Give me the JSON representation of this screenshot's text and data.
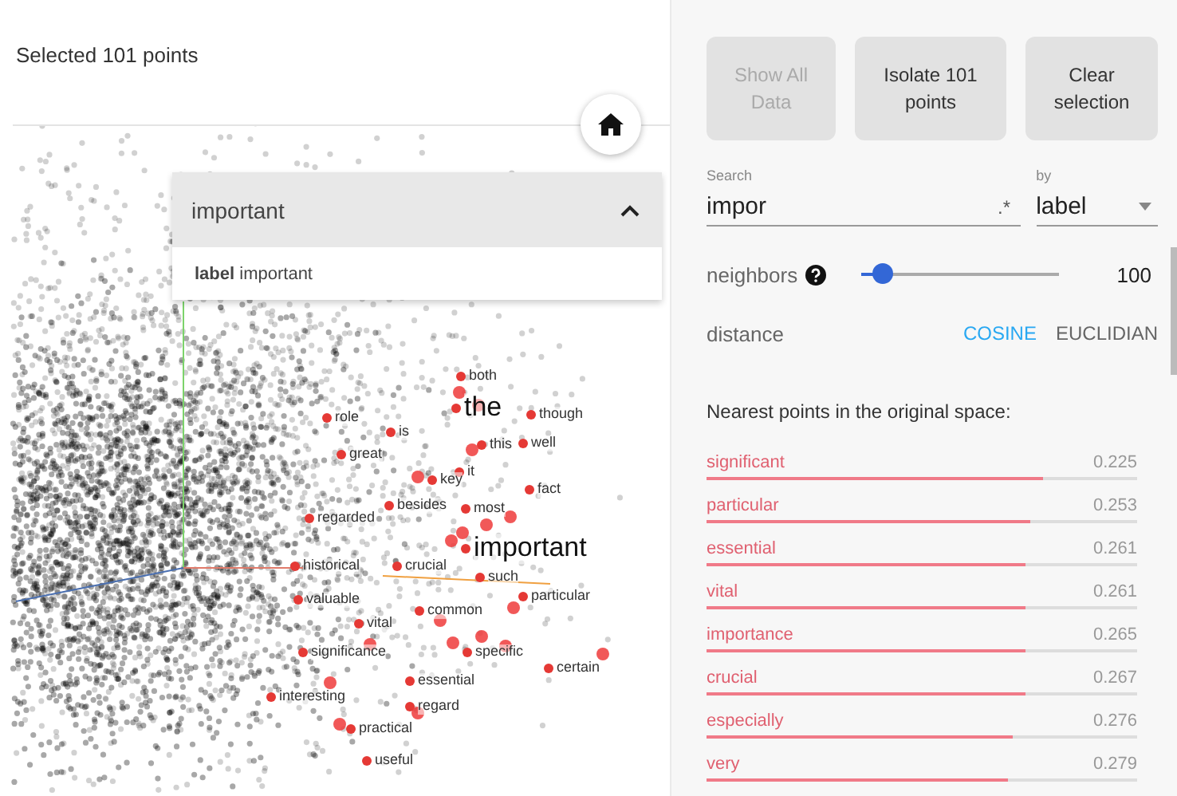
{
  "header": {
    "title": "Selected 101 points"
  },
  "inspector_card": {
    "title": "important",
    "expanded": true,
    "detail": "**label** important"
  },
  "point_labels": [
    {
      "text": "both",
      "kind": "normal"
    },
    {
      "text": "role",
      "kind": "normal"
    },
    {
      "text": "the",
      "kind": "large"
    },
    {
      "text": "though",
      "kind": "normal"
    },
    {
      "text": "is",
      "kind": "normal"
    },
    {
      "text": "this",
      "kind": "normal"
    },
    {
      "text": "well",
      "kind": "normal"
    },
    {
      "text": "great",
      "kind": "normal"
    },
    {
      "text": "key",
      "kind": "normal"
    },
    {
      "text": "it",
      "kind": "normal"
    },
    {
      "text": "fact",
      "kind": "normal"
    },
    {
      "text": "regarded",
      "kind": "normal"
    },
    {
      "text": "besides",
      "kind": "normal"
    },
    {
      "text": "most",
      "kind": "normal"
    },
    {
      "text": "important",
      "kind": "large"
    },
    {
      "text": "historical",
      "kind": "normal"
    },
    {
      "text": "crucial",
      "kind": "normal"
    },
    {
      "text": "such",
      "kind": "normal"
    },
    {
      "text": "valuable",
      "kind": "normal"
    },
    {
      "text": "common",
      "kind": "normal"
    },
    {
      "text": "particular",
      "kind": "normal"
    },
    {
      "text": "vital",
      "kind": "normal"
    },
    {
      "text": "significance",
      "kind": "normal"
    },
    {
      "text": "specific",
      "kind": "normal"
    },
    {
      "text": "certain",
      "kind": "normal"
    },
    {
      "text": "essential",
      "kind": "normal"
    },
    {
      "text": "interesting",
      "kind": "normal"
    },
    {
      "text": "regard",
      "kind": "normal"
    },
    {
      "text": "practical",
      "kind": "normal"
    },
    {
      "text": "useful",
      "kind": "normal"
    }
  ],
  "actions": [
    {
      "label": "Show All Data",
      "disabled": true
    },
    {
      "label": "Isolate 101 points",
      "disabled": false
    },
    {
      "label": "Clear selection",
      "disabled": false
    }
  ],
  "search": {
    "label": "Search",
    "value": "impor",
    "regex_toggle": ".*",
    "by_label": "by",
    "by_value": "label"
  },
  "neighbors": {
    "label": "neighbors",
    "level": 0.1,
    "value": "100"
  },
  "distance": {
    "label": "distance",
    "options": [
      {
        "label": "COSINE",
        "selected": true
      },
      {
        "label": "EUCLIDIAN",
        "selected": false
      }
    ]
  },
  "nearest": {
    "title": "Nearest points in the original space:",
    "items": [
      {
        "label": "significant",
        "value": "0.225",
        "level": 0.78
      },
      {
        "label": "particular",
        "value": "0.253",
        "level": 0.75
      },
      {
        "label": "essential",
        "value": "0.261",
        "level": 0.74
      },
      {
        "label": "vital",
        "value": "0.261",
        "level": 0.74
      },
      {
        "label": "importance",
        "value": "0.265",
        "level": 0.74
      },
      {
        "label": "crucial",
        "value": "0.267",
        "level": 0.74
      },
      {
        "label": "especially",
        "value": "0.276",
        "level": 0.71
      },
      {
        "label": "very",
        "value": "0.279",
        "level": 0.7
      }
    ]
  }
}
